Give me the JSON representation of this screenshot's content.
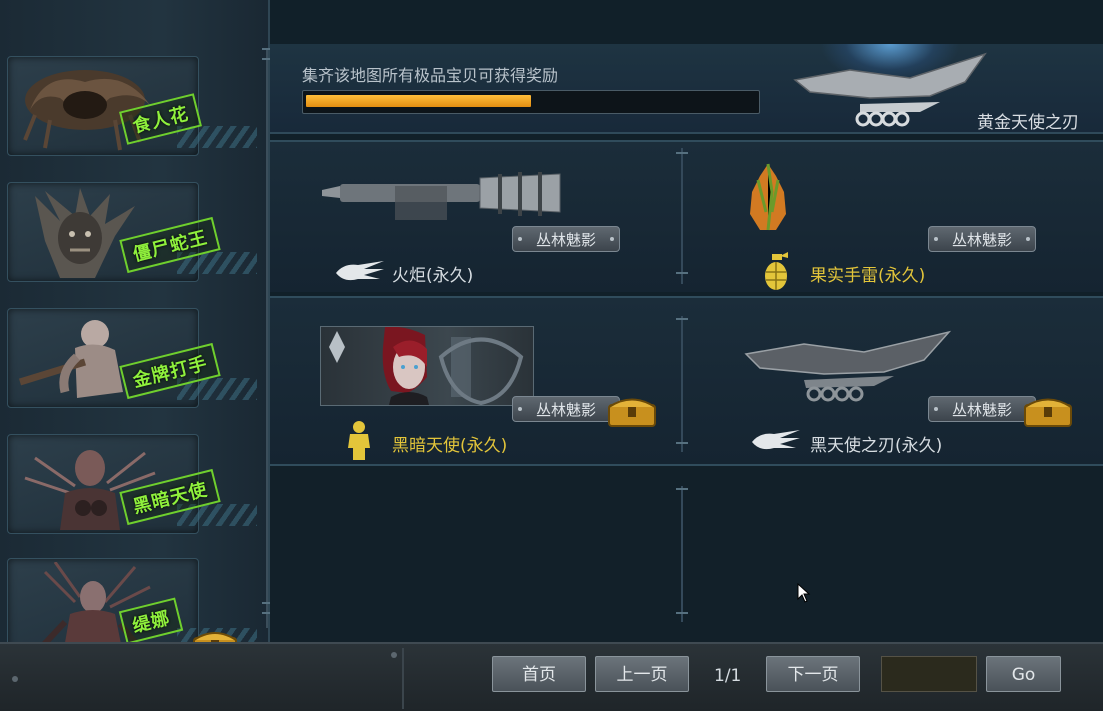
{
  "sidebar": {
    "bosses": [
      {
        "label": "食人花"
      },
      {
        "label": "僵尸蛇王"
      },
      {
        "label": "金牌打手"
      },
      {
        "label": "黑暗天使"
      },
      {
        "label": "缇娜",
        "has_chest": true
      }
    ]
  },
  "reward": {
    "description": "集齐该地图所有极品宝贝可获得奖励",
    "progress": 0.5,
    "name": "黄金天使之刃"
  },
  "items": [
    {
      "name": "火炬(永久)",
      "source": "丛林魅影",
      "type_icon": "melee-weapon-icon",
      "name_color": "white",
      "has_chest": false
    },
    {
      "name": "果实手雷(永久)",
      "source": "丛林魅影",
      "type_icon": "grenade-icon",
      "name_color": "gold",
      "has_chest": false
    },
    {
      "name": "黑暗天使(永久)",
      "source": "丛林魅影",
      "type_icon": "character-icon",
      "name_color": "gold",
      "has_chest": true
    },
    {
      "name": "黑天使之刃(永久)",
      "source": "丛林魅影",
      "type_icon": "melee-weapon-icon",
      "name_color": "white",
      "has_chest": true
    }
  ],
  "pagination": {
    "first_label": "首页",
    "prev_label": "上一页",
    "indicator": "1/1",
    "next_label": "下一页",
    "input_value": "",
    "go_label": "Go"
  },
  "colors": {
    "progress_orange": "#f0a020",
    "tag_green": "#8ff03c",
    "gold_text": "#e3c53a"
  }
}
